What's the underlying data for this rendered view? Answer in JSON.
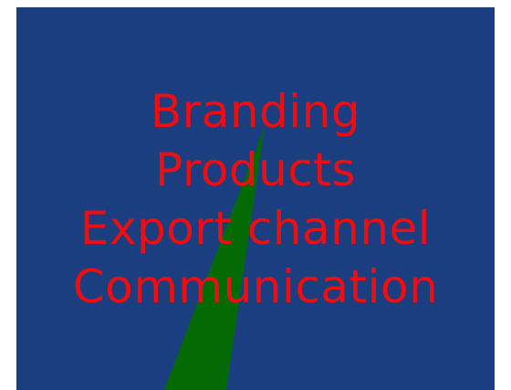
{
  "words": [
    "Branding",
    "Products",
    "Export channel",
    "Communication"
  ],
  "colors": {
    "background": "#1a3e80",
    "text": "#ee0d10",
    "wedge": "#046b04"
  }
}
